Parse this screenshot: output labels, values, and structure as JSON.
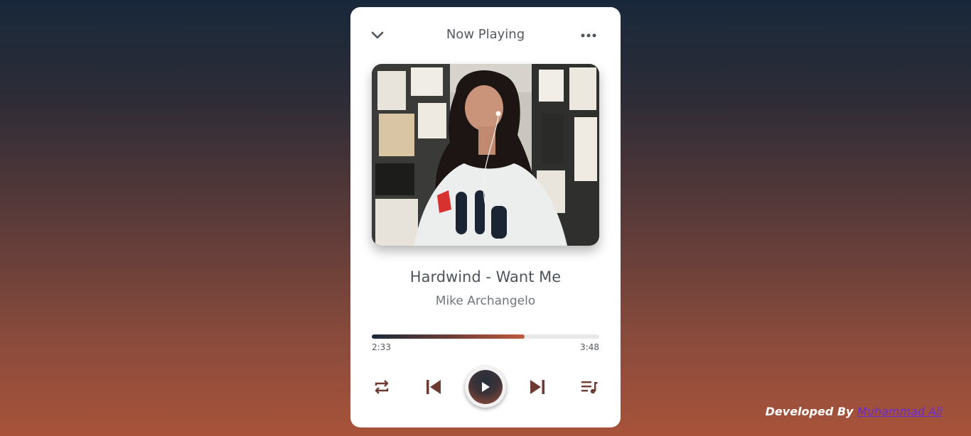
{
  "header": {
    "title": "Now Playing",
    "collapse_icon": "chevron-down-icon",
    "menu_icon": "more-dots-icon"
  },
  "track": {
    "title": "Hardwind - Want Me",
    "artist": "Mike Archangelo",
    "cover": "photo of a woman with long dark hair wearing earphones and a white t-shirt in front of a wall of sketches"
  },
  "progress": {
    "current": "2:33",
    "total": "3:48",
    "fraction": 0.671
  },
  "controls": {
    "repeat_icon": "repeat-icon",
    "previous_icon": "skip-previous-icon",
    "play_icon": "play-icon",
    "next_icon": "skip-next-icon",
    "playlist_icon": "playlist-icon"
  },
  "footer": {
    "credit_prefix": "Developed By",
    "credit_name": "Muhammad Ali"
  },
  "colors": {
    "accent_dark": "#1b2a3b",
    "accent_warm": "#c05a3e",
    "control_icon": "#6e3b33"
  }
}
